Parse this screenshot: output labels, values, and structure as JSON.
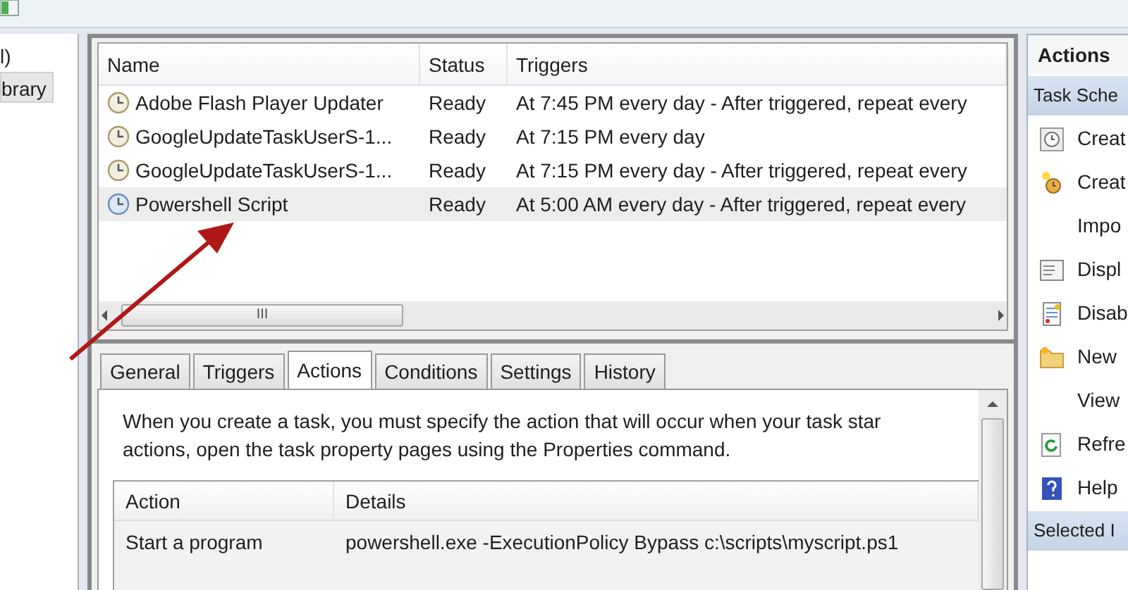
{
  "navigation_pane": {
    "items": [
      "l)",
      "brary"
    ]
  },
  "task_list": {
    "columns": [
      "Name",
      "Status",
      "Triggers"
    ],
    "rows": [
      {
        "name": "Adobe Flash Player Updater",
        "status": "Ready",
        "triggers": "At 7:45 PM every day - After triggered, repeat every",
        "selected": false
      },
      {
        "name": "GoogleUpdateTaskUserS-1...",
        "status": "Ready",
        "triggers": "At 7:15 PM every day",
        "selected": false
      },
      {
        "name": "GoogleUpdateTaskUserS-1...",
        "status": "Ready",
        "triggers": "At 7:15 PM every day - After triggered, repeat every",
        "selected": false
      },
      {
        "name": "Powershell Script",
        "status": "Ready",
        "triggers": "At 5:00 AM every day - After triggered, repeat every",
        "selected": true
      }
    ],
    "scroll_thumb": "III"
  },
  "tabs": [
    {
      "label": "General",
      "selected": false
    },
    {
      "label": "Triggers",
      "selected": false
    },
    {
      "label": "Actions",
      "selected": true
    },
    {
      "label": "Conditions",
      "selected": false
    },
    {
      "label": "Settings",
      "selected": false
    },
    {
      "label": "History",
      "selected": false
    }
  ],
  "actions_tab": {
    "description": [
      "When you create a task, you must specify the action that will occur when your task star",
      "actions, open the task property pages using the Properties command."
    ],
    "columns": [
      "Action",
      "Details"
    ],
    "rows": [
      {
        "action": "Start a program",
        "details": "powershell.exe -ExecutionPolicy Bypass c:\\scripts\\myscript.ps1"
      }
    ]
  },
  "actions_pane": {
    "title": "Actions",
    "items": [
      {
        "kind": "group",
        "label": "Task Sche"
      },
      {
        "kind": "item",
        "label": "Creat"
      },
      {
        "kind": "item",
        "label": "Creat"
      },
      {
        "kind": "item",
        "label": "Impo"
      },
      {
        "kind": "item",
        "label": "Displ"
      },
      {
        "kind": "item",
        "label": "Disab"
      },
      {
        "kind": "item",
        "label": "New"
      },
      {
        "kind": "item",
        "label": "View"
      },
      {
        "kind": "item",
        "label": "Refre"
      },
      {
        "kind": "item",
        "label": "Help"
      },
      {
        "kind": "group",
        "label": "Selected I"
      }
    ]
  }
}
